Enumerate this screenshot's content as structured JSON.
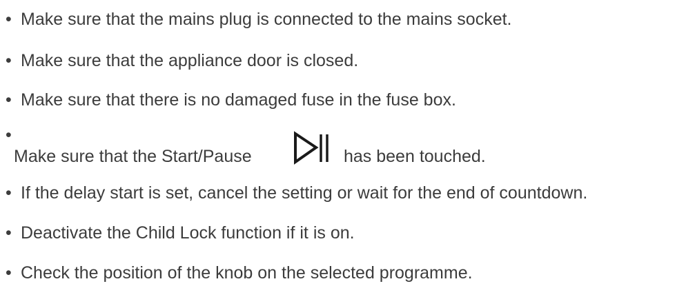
{
  "bullet_symbol": "•",
  "items": [
    {
      "text": "Make sure that the mains plug is connected to the mains socket."
    },
    {
      "text": "Make sure that the appliance door is closed."
    },
    {
      "text": "Make sure that there is no damaged fuse in the fuse box."
    },
    {
      "text_before": "Make sure that the Start/Pause",
      "icon": "play-pause-icon",
      "text_after": "has been touched."
    },
    {
      "text": "If the delay start is set, cancel the setting or wait for the end of countdown."
    },
    {
      "text": "Deactivate the Child Lock function if it is on."
    },
    {
      "text": "Check the position of the knob on the selected programme."
    }
  ]
}
